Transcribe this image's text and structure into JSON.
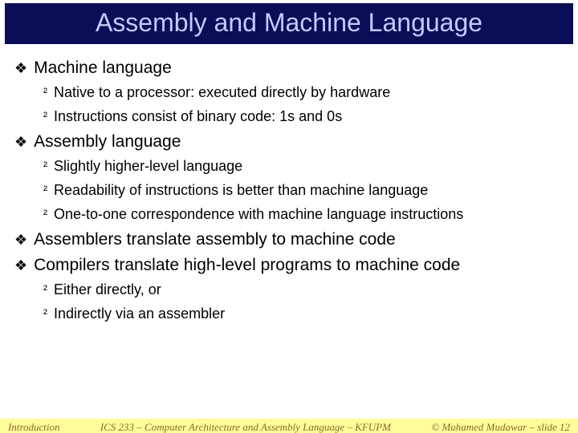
{
  "title": "Assembly and Machine Language",
  "bullets": [
    {
      "level": 1,
      "text": "Machine language"
    },
    {
      "level": 2,
      "text": "Native to a processor: executed directly by hardware"
    },
    {
      "level": 2,
      "text": "Instructions consist of binary code: 1s and 0s"
    },
    {
      "level": 1,
      "text": "Assembly language"
    },
    {
      "level": 2,
      "text": "Slightly higher-level language"
    },
    {
      "level": 2,
      "text": "Readability of instructions is better than machine language"
    },
    {
      "level": 2,
      "text": "One-to-one correspondence with machine language instructions"
    },
    {
      "level": 1,
      "text": "Assemblers translate assembly to machine code"
    },
    {
      "level": 1,
      "text": "Compilers translate high-level programs to machine code"
    },
    {
      "level": 2,
      "text": "Either directly, or"
    },
    {
      "level": 2,
      "text": "Indirectly via an assembler"
    }
  ],
  "footer": {
    "left": "Introduction",
    "center": "ICS 233 – Computer Architecture and Assembly Language – KFUPM",
    "right": "© Muhamed Mudawar – slide 12"
  },
  "glyphs": {
    "level1": "❖",
    "level2": "²"
  }
}
